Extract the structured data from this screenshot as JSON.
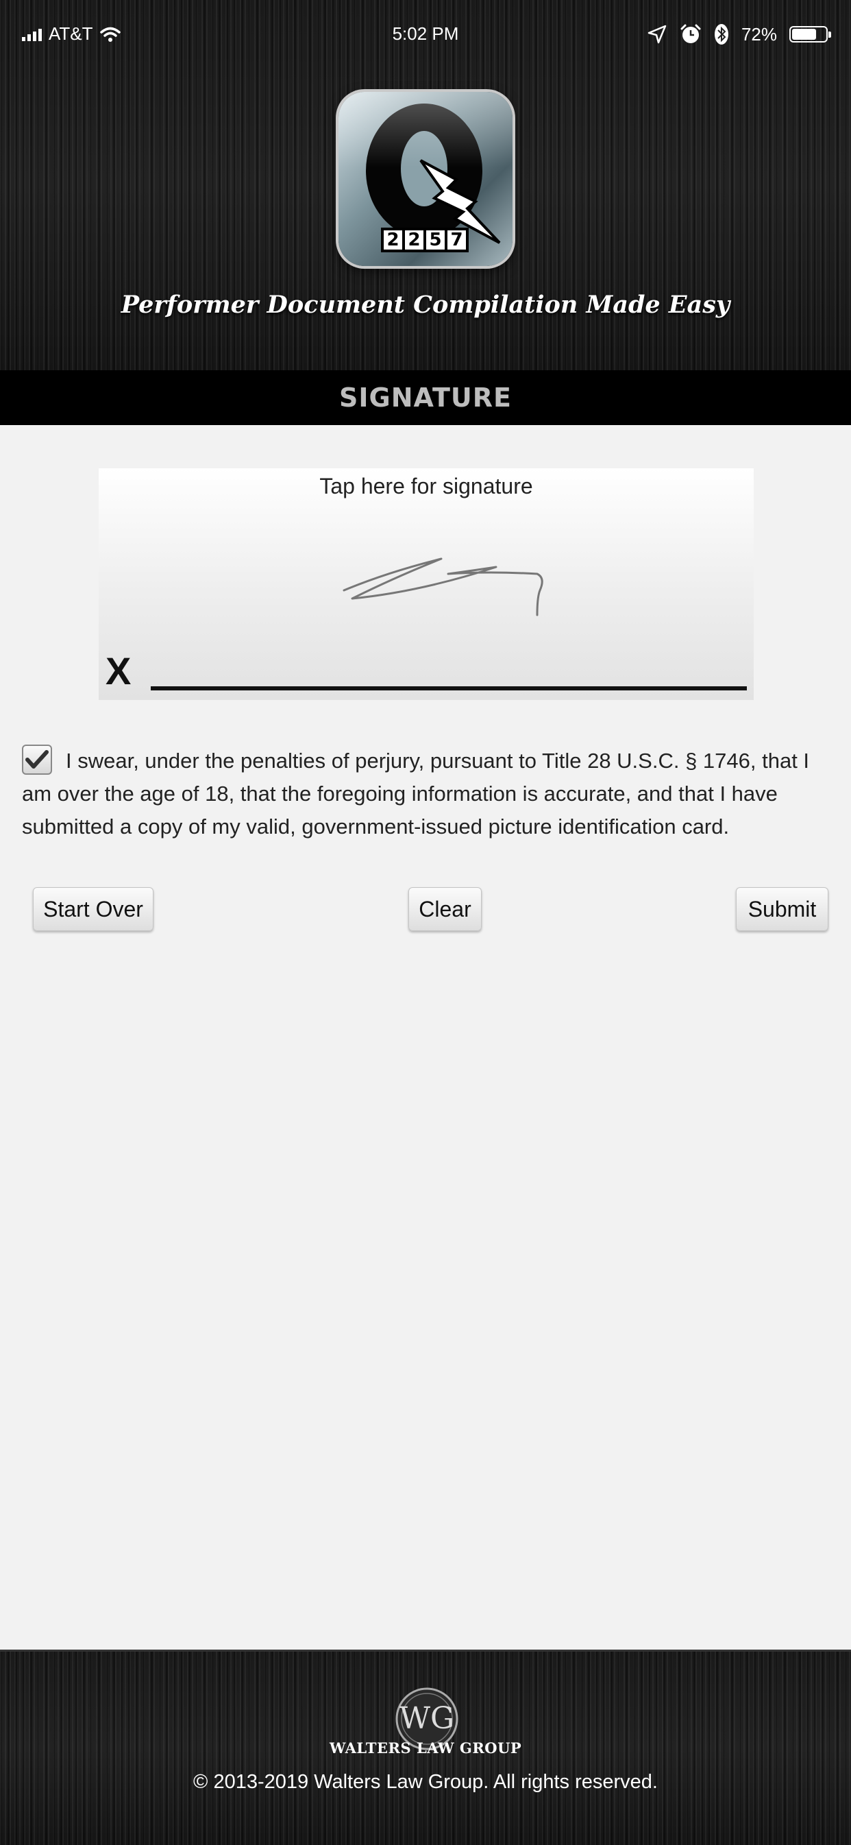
{
  "status_bar": {
    "carrier": "AT&T",
    "time": "5:02 PM",
    "battery_text": "72%",
    "battery_level": 0.72
  },
  "header": {
    "app_icon": "q-2257-logo",
    "app_icon_digits": [
      "2",
      "2",
      "5",
      "7"
    ],
    "tagline": "Performer Document Compilation Made Easy"
  },
  "title_bar": {
    "title": "SIGNATURE"
  },
  "signature": {
    "prompt": "Tap here for signature",
    "x_mark": "X"
  },
  "oath": {
    "checked": true,
    "text": "I swear, under the penalties of perjury, pursuant to Title 28 U.S.C. § 1746, that I am over the age of 18, that the foregoing information is accurate, and that I have submitted a copy of my valid, government-issued picture identification card."
  },
  "buttons": {
    "start_over": "Start Over",
    "clear": "Clear",
    "submit": "Submit"
  },
  "footer": {
    "logo_initials": "WG",
    "company": "WALTERS LAW GROUP",
    "copyright": "© 2013-2019 Walters Law Group. All rights reserved."
  },
  "colors": {
    "title_text": "#bdbdbd",
    "page_background": "#f2f2f2",
    "header_background": "#1a1a1a"
  }
}
